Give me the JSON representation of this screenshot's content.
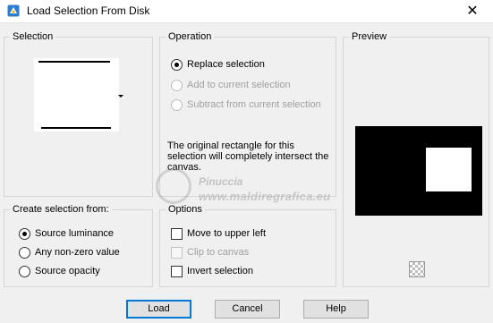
{
  "window": {
    "title": "Load Selection From Disk",
    "close_glyph": "✕",
    "icon": "psp-app-icon"
  },
  "selection_group": {
    "title": "Selection"
  },
  "operation_group": {
    "title": "Operation",
    "options": [
      {
        "label": "Replace selection",
        "checked": true,
        "enabled": true
      },
      {
        "label": "Add to current selection",
        "checked": false,
        "enabled": false
      },
      {
        "label": "Subtract from current selection",
        "checked": false,
        "enabled": false
      }
    ],
    "info": "The original rectangle for this selection will completely intersect the canvas."
  },
  "preview_group": {
    "title": "Preview"
  },
  "create_group": {
    "title": "Create selection from:",
    "options": [
      {
        "label": "Source luminance",
        "checked": true
      },
      {
        "label": "Any non-zero value",
        "checked": false
      },
      {
        "label": "Source opacity",
        "checked": false
      }
    ]
  },
  "options_group": {
    "title": "Options",
    "items": [
      {
        "label": "Move to upper left",
        "checked": false,
        "enabled": true
      },
      {
        "label": "Clip to canvas",
        "checked": false,
        "enabled": false
      },
      {
        "label": "Invert selection",
        "checked": false,
        "enabled": true
      }
    ]
  },
  "buttons": {
    "load": "Load",
    "cancel": "Cancel",
    "help": "Help"
  },
  "watermark": {
    "name": "Pinuccia",
    "url": "www.maldiregrafica.eu"
  }
}
